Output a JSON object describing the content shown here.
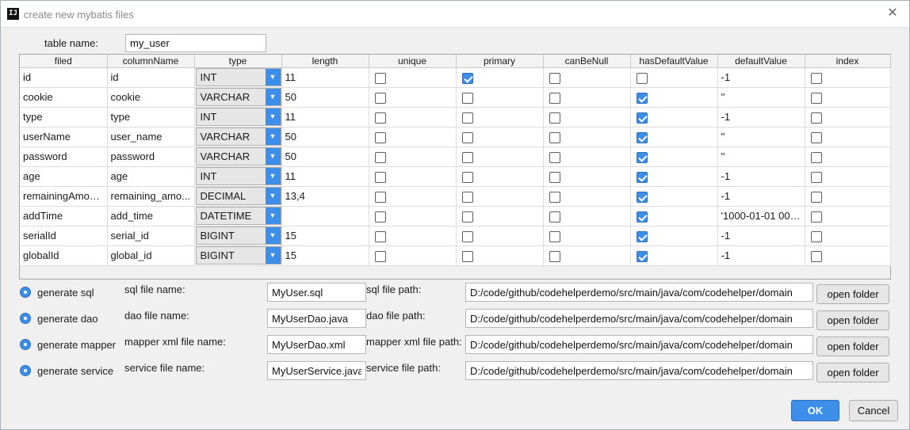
{
  "window": {
    "app_icon": "IJ",
    "title": "create new mybatis files",
    "close_icon": "✕"
  },
  "table_name": {
    "label": "table name:",
    "value": "my_user"
  },
  "grid": {
    "columns": [
      "filed",
      "columnName",
      "type",
      "length",
      "unique",
      "primary",
      "canBeNull",
      "hasDefaultValue",
      "defaultValue",
      "index"
    ],
    "dropdown_icon": "▼",
    "rows": [
      {
        "filed": "id",
        "columnName": "id",
        "type": "INT",
        "length": "11",
        "unique": false,
        "primary": true,
        "canBeNull": false,
        "hasDefaultValue": false,
        "defaultValue": "-1",
        "index": false
      },
      {
        "filed": "cookie",
        "columnName": "cookie",
        "type": "VARCHAR",
        "length": "50",
        "unique": false,
        "primary": false,
        "canBeNull": false,
        "hasDefaultValue": true,
        "defaultValue": "''",
        "index": false
      },
      {
        "filed": "type",
        "columnName": "type",
        "type": "INT",
        "length": "11",
        "unique": false,
        "primary": false,
        "canBeNull": false,
        "hasDefaultValue": true,
        "defaultValue": "-1",
        "index": false
      },
      {
        "filed": "userName",
        "columnName": "user_name",
        "type": "VARCHAR",
        "length": "50",
        "unique": false,
        "primary": false,
        "canBeNull": false,
        "hasDefaultValue": true,
        "defaultValue": "''",
        "index": false
      },
      {
        "filed": "password",
        "columnName": "password",
        "type": "VARCHAR",
        "length": "50",
        "unique": false,
        "primary": false,
        "canBeNull": false,
        "hasDefaultValue": true,
        "defaultValue": "''",
        "index": false
      },
      {
        "filed": "age",
        "columnName": "age",
        "type": "INT",
        "length": "11",
        "unique": false,
        "primary": false,
        "canBeNull": false,
        "hasDefaultValue": true,
        "defaultValue": "-1",
        "index": false
      },
      {
        "filed": "remainingAmou...",
        "columnName": "remaining_amo...",
        "type": "DECIMAL",
        "length": "13,4",
        "unique": false,
        "primary": false,
        "canBeNull": false,
        "hasDefaultValue": true,
        "defaultValue": "-1",
        "index": false
      },
      {
        "filed": "addTime",
        "columnName": "add_time",
        "type": "DATETIME",
        "length": "",
        "unique": false,
        "primary": false,
        "canBeNull": false,
        "hasDefaultValue": true,
        "defaultValue": "'1000-01-01 00:...",
        "index": false
      },
      {
        "filed": "serialId",
        "columnName": "serial_id",
        "type": "BIGINT",
        "length": "15",
        "unique": false,
        "primary": false,
        "canBeNull": false,
        "hasDefaultValue": true,
        "defaultValue": "-1",
        "index": false
      },
      {
        "filed": "globalId",
        "columnName": "global_id",
        "type": "BIGINT",
        "length": "15",
        "unique": false,
        "primary": false,
        "canBeNull": false,
        "hasDefaultValue": true,
        "defaultValue": "-1",
        "index": false
      }
    ]
  },
  "generate": [
    {
      "key": "sql",
      "label": "generate sql",
      "selected": true,
      "file_label": "sql file name:",
      "file_name": "MyUser.sql",
      "path_label": "sql file path:",
      "path": "D:/code/github/codehelperdemo/src/main/java/com/codehelper/domain",
      "button": "open folder"
    },
    {
      "key": "dao",
      "label": "generate dao",
      "selected": true,
      "file_label": "dao file name:",
      "file_name": "MyUserDao.java",
      "path_label": "dao file path:",
      "path": "D:/code/github/codehelperdemo/src/main/java/com/codehelper/domain",
      "button": "open folder"
    },
    {
      "key": "mapper",
      "label": "generate mapper",
      "selected": true,
      "file_label": "mapper xml file name:",
      "file_name": "MyUserDao.xml",
      "path_label": "mapper xml file path:",
      "path": "D:/code/github/codehelperdemo/src/main/java/com/codehelper/domain",
      "button": "open folder"
    },
    {
      "key": "service",
      "label": "generate service",
      "selected": true,
      "file_label": "service file name:",
      "file_name": "MyUserService.java",
      "path_label": "service file path:",
      "path": "D:/code/github/codehelperdemo/src/main/java/com/codehelper/domain",
      "button": "open folder"
    }
  ],
  "buttons": {
    "ok": "OK",
    "cancel": "Cancel"
  },
  "colors": {
    "accent": "#3d8ee8",
    "background": "#f0f0f0"
  }
}
